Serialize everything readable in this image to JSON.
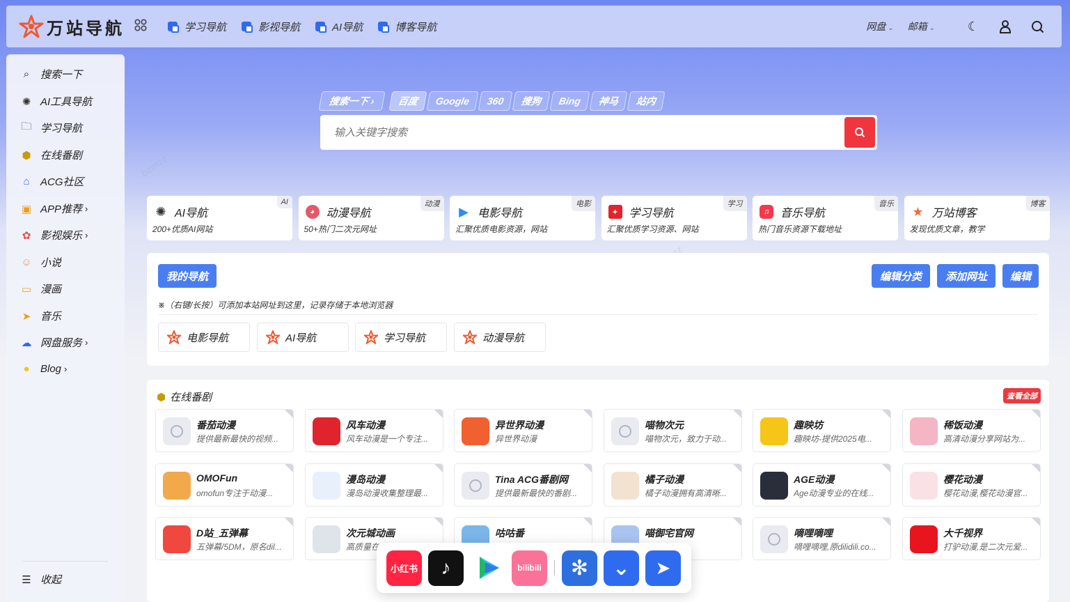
{
  "header": {
    "logo_text": "万站导航",
    "nav": [
      "学习导航",
      "影视导航",
      "AI导航",
      "博客导航"
    ],
    "dropdowns": [
      "网盘",
      "邮箱"
    ]
  },
  "sidebar": {
    "items": [
      {
        "label": "搜索一下",
        "icon": "search-icon",
        "arrow": ""
      },
      {
        "label": "AI工具导航",
        "icon": "ai-icon",
        "arrow": ""
      },
      {
        "label": "学习导航",
        "icon": "folder-icon",
        "arrow": ""
      },
      {
        "label": "在线番剧",
        "icon": "box-icon",
        "arrow": ""
      },
      {
        "label": "ACG社区",
        "icon": "house-icon",
        "arrow": ""
      },
      {
        "label": "APP推荐",
        "icon": "app-icon",
        "arrow": "›"
      },
      {
        "label": "影视娱乐",
        "icon": "film-icon",
        "arrow": "›"
      },
      {
        "label": "小说",
        "icon": "cat-icon",
        "arrow": ""
      },
      {
        "label": "漫画",
        "icon": "comic-icon",
        "arrow": ""
      },
      {
        "label": "音乐",
        "icon": "plane-icon",
        "arrow": ""
      },
      {
        "label": "网盘服务",
        "icon": "cloud-icon",
        "arrow": "›"
      },
      {
        "label": "Blog",
        "icon": "blog-icon",
        "arrow": "›"
      }
    ],
    "collapse": "收起"
  },
  "search": {
    "tabs": [
      "搜索一下 ›",
      "百度",
      "Google",
      "360",
      "搜狗",
      "Bing",
      "神马",
      "站内"
    ],
    "active": "百度",
    "placeholder": "输入关键字搜索"
  },
  "cards": [
    {
      "title": "AI导航",
      "desc": "200+优质AI网站",
      "badge": "AI",
      "color": "#333333"
    },
    {
      "title": "动漫导航",
      "desc": "50+热门二次元网址",
      "badge": "动漫",
      "color": "#e05a6a"
    },
    {
      "title": "电影导航",
      "desc": "汇聚优质电影资源，网站",
      "badge": "电影",
      "color": "#2f8cf0"
    },
    {
      "title": "学习导航",
      "desc": "汇聚优质学习资源、网站",
      "badge": "学习",
      "color": "#e0242d"
    },
    {
      "title": "音乐导航",
      "desc": "热门音乐资源下载地址",
      "badge": "音乐",
      "color": "#f23a4f"
    },
    {
      "title": "万站博客",
      "desc": "发现优质文章，教学",
      "badge": "博客",
      "color": "#f06a3a"
    }
  ],
  "mynav": {
    "title": "我的导航",
    "buttons": [
      "编辑分类",
      "添加网址",
      "编辑"
    ],
    "tip": "※（右键/长按）可添加本站网址到这里，记录存储于本地浏览器",
    "chips": [
      "电影导航",
      "AI导航",
      "学习导航",
      "动漫导航"
    ]
  },
  "anime": {
    "title": "在线番剧",
    "view_all": "查看全部",
    "sites": [
      {
        "name": "番茄动漫",
        "desc": "提供最新最快的视频...",
        "icon": "globe"
      },
      {
        "name": "风车动漫",
        "desc": "风车动漫是一个专注...",
        "icon": "#e0242d"
      },
      {
        "name": "异世界动漫",
        "desc": "异世界动漫",
        "icon": "#f06030"
      },
      {
        "name": "喵物次元",
        "desc": "喵物次元，致力于动...",
        "icon": "globe"
      },
      {
        "name": "趣映坊",
        "desc": "趣映坊-提供2025电...",
        "icon": "#f5c518"
      },
      {
        "name": "稀饭动漫",
        "desc": "高清动漫分享网站为...",
        "icon": "#f4b6c4"
      },
      {
        "name": "OMOFun",
        "desc": "omofun专注于动漫...",
        "icon": "#f2a94a"
      },
      {
        "name": "漫岛动漫",
        "desc": "漫岛动漫收集整理最...",
        "icon": "#e8f0fb"
      },
      {
        "name": "Tina ACG番剧网",
        "desc": "提供最新最快的番剧...",
        "icon": "globe"
      },
      {
        "name": "橘子动漫",
        "desc": "橘子动漫拥有高清晰...",
        "icon": "#f3e2d0"
      },
      {
        "name": "AGE动漫",
        "desc": "Age动漫专业的在线...",
        "icon": "#2a2d3a"
      },
      {
        "name": "樱花动漫",
        "desc": "樱花动漫,樱花动漫官...",
        "icon": "#f9e1e6"
      },
      {
        "name": "D站_五弹幕",
        "desc": "五弹幕/5DM，原名dil...",
        "icon": "#f0483f"
      },
      {
        "name": "次元城动画",
        "desc": "高质量在线动漫...",
        "icon": "#dfe3ea"
      },
      {
        "name": "咕咕番",
        "desc": "",
        "icon": "#7ab6e8"
      },
      {
        "name": "喵御宅官网",
        "desc": "喵御宅...",
        "icon": "#a9c4ee"
      },
      {
        "name": "嘀哩嘀哩",
        "desc": "嘀哩嘀哩,原dilidili.co...",
        "icon": "globe"
      },
      {
        "name": "大千视界",
        "desc": "打驴动漫,是二次元爱...",
        "icon": "#e8141e"
      }
    ]
  },
  "dock": [
    {
      "name": "小红书",
      "color": "#ff2442",
      "label": "小红书"
    },
    {
      "name": "抖音",
      "color": "#111111",
      "label": "♪"
    },
    {
      "name": "优酷",
      "color": "#ffffff",
      "label": ""
    },
    {
      "name": "哔哩哔哩",
      "color": "#fb7299",
      "label": "bilibili"
    },
    {
      "name": "风车",
      "color": "#2e6fe0",
      "label": "✻"
    },
    {
      "name": "下载",
      "color": "#2f6bef",
      "label": "⌄"
    },
    {
      "name": "纸飞机",
      "color": "#2f6bef",
      "label": "➤"
    }
  ]
}
